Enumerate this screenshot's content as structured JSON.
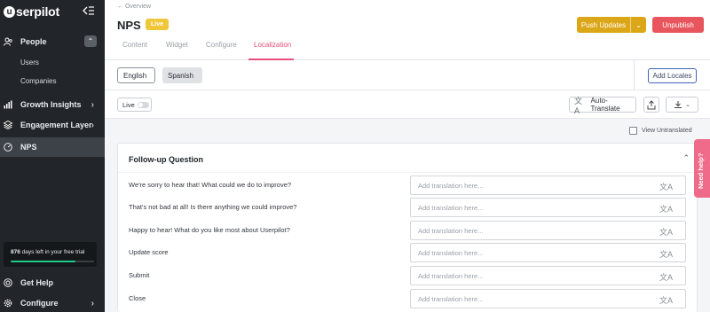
{
  "sidebar": {
    "logo_letter": "u",
    "logo_text": "serpilot",
    "items": [
      {
        "label": "People"
      },
      {
        "label": "Growth Insights"
      },
      {
        "label": "Engagement Layer"
      },
      {
        "label": "NPS"
      }
    ],
    "sub_items": [
      {
        "label": "Users"
      },
      {
        "label": "Companies"
      }
    ],
    "trial": {
      "days": "876",
      "text": " days left in your free trial",
      "progress": 0.78
    },
    "bottom": [
      {
        "label": "Get Help"
      },
      {
        "label": "Configure"
      }
    ]
  },
  "header": {
    "back_label": "← Overview",
    "title": "NPS",
    "status_badge": "Live",
    "push_label": "Push Updates",
    "unpublish_label": "Unpublish",
    "tabs": [
      {
        "label": "Content",
        "active": false
      },
      {
        "label": "Widget",
        "active": false
      },
      {
        "label": "Configure",
        "active": false
      },
      {
        "label": "Localization",
        "active": true
      }
    ]
  },
  "locales": {
    "chips": [
      {
        "label": "English"
      },
      {
        "label": "Spanish"
      }
    ],
    "add_label": "Add Locales"
  },
  "controls": {
    "live_label": "Live",
    "auto_translate_label": "Auto-Translate",
    "view_untranslated_label": "View Untranslated"
  },
  "panel": {
    "title": "Follow-up Question",
    "placeholder": "Add translation here...",
    "rows": [
      {
        "label": "We're sorry to hear that! What could we do to improve?"
      },
      {
        "label": "That's not bad at all! Is there anything we could improve?"
      },
      {
        "label": "Happy to hear! What do you like most about Userpilot?"
      },
      {
        "label": "Update score"
      },
      {
        "label": "Submit"
      },
      {
        "label": "Close"
      }
    ]
  },
  "help_tab": {
    "label": "Need help?"
  },
  "colors": {
    "sidebar_bg": "#22262b",
    "accent_pink": "#e5517c",
    "push_yellow": "#dba617",
    "unpublish_red": "#e8555c",
    "live_badge": "#f0c63a",
    "trial_green": "#1fc98a"
  }
}
